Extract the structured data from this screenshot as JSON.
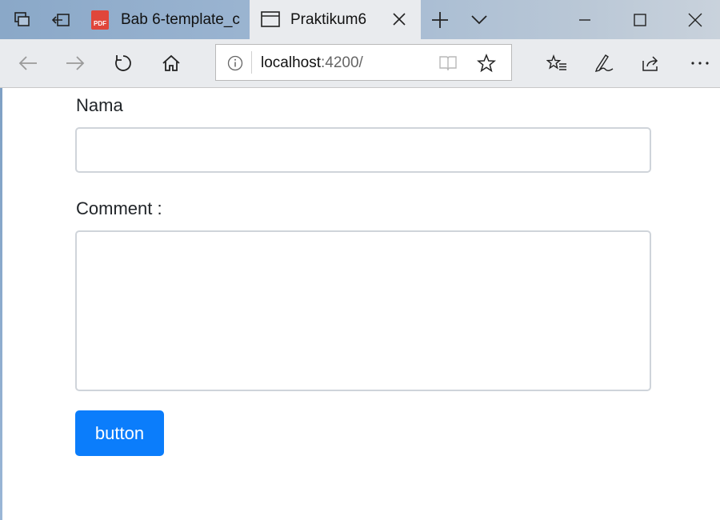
{
  "browser": {
    "tabs": [
      {
        "title": "Bab 6-template_c",
        "icon": "pdf-icon"
      },
      {
        "title": "Praktikum6",
        "icon": "window-icon"
      }
    ],
    "pdf_icon_text": "PDF",
    "address": {
      "host": "localhost",
      "port_path": ":4200/"
    }
  },
  "form": {
    "nama_label": "Nama",
    "nama_value": "",
    "comment_label": "Comment :",
    "comment_value": "",
    "button_label": "button"
  },
  "colors": {
    "accent": "#0b7dfb",
    "tabbar": "#9db6d2"
  }
}
